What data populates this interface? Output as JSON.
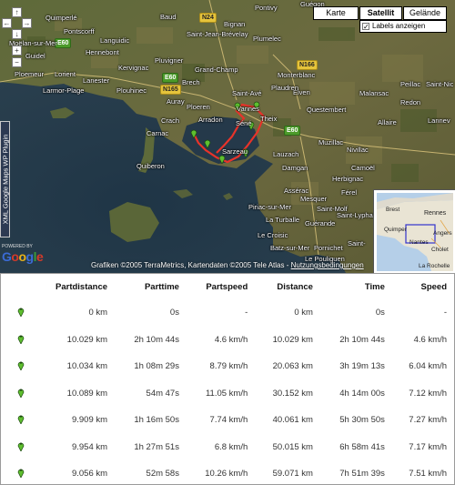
{
  "map": {
    "type_buttons": [
      "Karte",
      "Satellit",
      "Gelände"
    ],
    "active_type": "Satellit",
    "labels_checkbox": {
      "label": "Labels anzeigen",
      "checked": true
    },
    "plugin_tab": "XML Google Maps WP Plugin",
    "powered_by": "POWERED BY",
    "attribution": "Grafiken ©2005 TerraMetrics, Kartendaten ©2005 Tele Atlas - ",
    "terms_link": "Nutzungsbedingungen",
    "roads": [
      "N24",
      "N165",
      "N166",
      "E60",
      "E60",
      "E60"
    ],
    "places": [
      "Guégon",
      "Pontivy",
      "Baud",
      "Bignan",
      "Saint-Jean-Brévelay",
      "Plumelec",
      "Guidel",
      "Ploemeur",
      "Lorient",
      "Larmor-Plage",
      "Hennebont",
      "Languidic",
      "Lanester",
      "Kervignac",
      "Pluvigner",
      "Plouhinec",
      "Grand-Champ",
      "Brech",
      "Auray",
      "Ploeren",
      "Saint-Avé",
      "Vannes",
      "Theix",
      "Séné",
      "Arradon",
      "Sarzeau",
      "Crach",
      "Carnac",
      "Quiberon",
      "Questembert",
      "Muzillac",
      "Nivillac",
      "Herbignac",
      "Piriac-sur-Mer",
      "La Turballe",
      "Guérande",
      "Le Croisic",
      "Batz-sur-Mer",
      "Pornichet",
      "Saint-",
      "Mesquer",
      "Le Pouliguen",
      "Redon",
      "Allaire",
      "Malansac",
      "Elven",
      "Monterblanc",
      "Plaudren",
      "Peillac",
      "Saint-Nic",
      "Lannev",
      "Lauzach",
      "Damgan",
      "Camoël",
      "Férel",
      "Assérac",
      "Saint-Lyphard",
      "Saint-Molf",
      "Moëlan-sur-Mer",
      "Quimperlé",
      "Pontscorff"
    ],
    "overview_places": [
      "Brest",
      "Rennes",
      "Quimper",
      "Nantes",
      "Angers",
      "Cholet",
      "La Rochelle"
    ],
    "zoom_buttons": [
      "+",
      "−"
    ],
    "pan_buttons": [
      "↑",
      "←",
      "→",
      "↓"
    ]
  },
  "table": {
    "headers": [
      "Partdistance",
      "Parttime",
      "Partspeed",
      "Distance",
      "Time",
      "Speed"
    ],
    "rows": [
      [
        "0 km",
        "0s",
        "-",
        "0 km",
        "0s",
        "-"
      ],
      [
        "10.029 km",
        "2h 10m 44s",
        "4.6 km/h",
        "10.029 km",
        "2h 10m 44s",
        "4.6 km/h"
      ],
      [
        "10.034 km",
        "1h 08m 29s",
        "8.79 km/h",
        "20.063 km",
        "3h 19m 13s",
        "6.04 km/h"
      ],
      [
        "10.089 km",
        "54m 47s",
        "11.05 km/h",
        "30.152 km",
        "4h 14m 00s",
        "7.12 km/h"
      ],
      [
        "9.909 km",
        "1h 16m 50s",
        "7.74 km/h",
        "40.061 km",
        "5h 30m 50s",
        "7.27 km/h"
      ],
      [
        "9.954 km",
        "1h 27m 51s",
        "6.8 km/h",
        "50.015 km",
        "6h 58m 41s",
        "7.17 km/h"
      ],
      [
        "9.056 km",
        "52m 58s",
        "10.26 km/h",
        "59.071 km",
        "7h 51m 39s",
        "7.51 km/h"
      ]
    ]
  },
  "colors": {
    "route": "#e8332a",
    "marker": "#5fbf2f",
    "sea": "#243848",
    "land": "#6a6a3a"
  }
}
